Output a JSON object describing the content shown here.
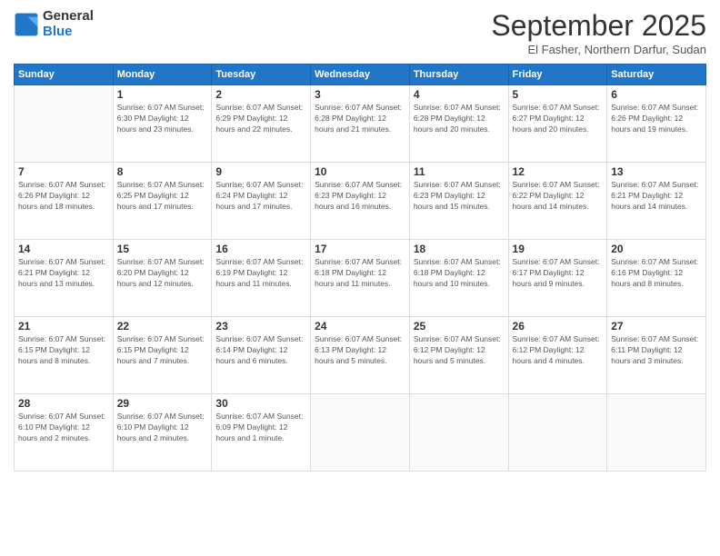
{
  "logo": {
    "general": "General",
    "blue": "Blue"
  },
  "title": "September 2025",
  "subtitle": "El Fasher, Northern Darfur, Sudan",
  "days_header": [
    "Sunday",
    "Monday",
    "Tuesday",
    "Wednesday",
    "Thursday",
    "Friday",
    "Saturday"
  ],
  "weeks": [
    [
      {
        "day": "",
        "info": ""
      },
      {
        "day": "1",
        "info": "Sunrise: 6:07 AM\nSunset: 6:30 PM\nDaylight: 12 hours\nand 23 minutes."
      },
      {
        "day": "2",
        "info": "Sunrise: 6:07 AM\nSunset: 6:29 PM\nDaylight: 12 hours\nand 22 minutes."
      },
      {
        "day": "3",
        "info": "Sunrise: 6:07 AM\nSunset: 6:28 PM\nDaylight: 12 hours\nand 21 minutes."
      },
      {
        "day": "4",
        "info": "Sunrise: 6:07 AM\nSunset: 6:28 PM\nDaylight: 12 hours\nand 20 minutes."
      },
      {
        "day": "5",
        "info": "Sunrise: 6:07 AM\nSunset: 6:27 PM\nDaylight: 12 hours\nand 20 minutes."
      },
      {
        "day": "6",
        "info": "Sunrise: 6:07 AM\nSunset: 6:26 PM\nDaylight: 12 hours\nand 19 minutes."
      }
    ],
    [
      {
        "day": "7",
        "info": "Sunrise: 6:07 AM\nSunset: 6:26 PM\nDaylight: 12 hours\nand 18 minutes."
      },
      {
        "day": "8",
        "info": "Sunrise: 6:07 AM\nSunset: 6:25 PM\nDaylight: 12 hours\nand 17 minutes."
      },
      {
        "day": "9",
        "info": "Sunrise: 6:07 AM\nSunset: 6:24 PM\nDaylight: 12 hours\nand 17 minutes."
      },
      {
        "day": "10",
        "info": "Sunrise: 6:07 AM\nSunset: 6:23 PM\nDaylight: 12 hours\nand 16 minutes."
      },
      {
        "day": "11",
        "info": "Sunrise: 6:07 AM\nSunset: 6:23 PM\nDaylight: 12 hours\nand 15 minutes."
      },
      {
        "day": "12",
        "info": "Sunrise: 6:07 AM\nSunset: 6:22 PM\nDaylight: 12 hours\nand 14 minutes."
      },
      {
        "day": "13",
        "info": "Sunrise: 6:07 AM\nSunset: 6:21 PM\nDaylight: 12 hours\nand 14 minutes."
      }
    ],
    [
      {
        "day": "14",
        "info": "Sunrise: 6:07 AM\nSunset: 6:21 PM\nDaylight: 12 hours\nand 13 minutes."
      },
      {
        "day": "15",
        "info": "Sunrise: 6:07 AM\nSunset: 6:20 PM\nDaylight: 12 hours\nand 12 minutes."
      },
      {
        "day": "16",
        "info": "Sunrise: 6:07 AM\nSunset: 6:19 PM\nDaylight: 12 hours\nand 11 minutes."
      },
      {
        "day": "17",
        "info": "Sunrise: 6:07 AM\nSunset: 6:18 PM\nDaylight: 12 hours\nand 11 minutes."
      },
      {
        "day": "18",
        "info": "Sunrise: 6:07 AM\nSunset: 6:18 PM\nDaylight: 12 hours\nand 10 minutes."
      },
      {
        "day": "19",
        "info": "Sunrise: 6:07 AM\nSunset: 6:17 PM\nDaylight: 12 hours\nand 9 minutes."
      },
      {
        "day": "20",
        "info": "Sunrise: 6:07 AM\nSunset: 6:16 PM\nDaylight: 12 hours\nand 8 minutes."
      }
    ],
    [
      {
        "day": "21",
        "info": "Sunrise: 6:07 AM\nSunset: 6:15 PM\nDaylight: 12 hours\nand 8 minutes."
      },
      {
        "day": "22",
        "info": "Sunrise: 6:07 AM\nSunset: 6:15 PM\nDaylight: 12 hours\nand 7 minutes."
      },
      {
        "day": "23",
        "info": "Sunrise: 6:07 AM\nSunset: 6:14 PM\nDaylight: 12 hours\nand 6 minutes."
      },
      {
        "day": "24",
        "info": "Sunrise: 6:07 AM\nSunset: 6:13 PM\nDaylight: 12 hours\nand 5 minutes."
      },
      {
        "day": "25",
        "info": "Sunrise: 6:07 AM\nSunset: 6:12 PM\nDaylight: 12 hours\nand 5 minutes."
      },
      {
        "day": "26",
        "info": "Sunrise: 6:07 AM\nSunset: 6:12 PM\nDaylight: 12 hours\nand 4 minutes."
      },
      {
        "day": "27",
        "info": "Sunrise: 6:07 AM\nSunset: 6:11 PM\nDaylight: 12 hours\nand 3 minutes."
      }
    ],
    [
      {
        "day": "28",
        "info": "Sunrise: 6:07 AM\nSunset: 6:10 PM\nDaylight: 12 hours\nand 2 minutes."
      },
      {
        "day": "29",
        "info": "Sunrise: 6:07 AM\nSunset: 6:10 PM\nDaylight: 12 hours\nand 2 minutes."
      },
      {
        "day": "30",
        "info": "Sunrise: 6:07 AM\nSunset: 6:09 PM\nDaylight: 12 hours\nand 1 minute."
      },
      {
        "day": "",
        "info": ""
      },
      {
        "day": "",
        "info": ""
      },
      {
        "day": "",
        "info": ""
      },
      {
        "day": "",
        "info": ""
      }
    ]
  ]
}
